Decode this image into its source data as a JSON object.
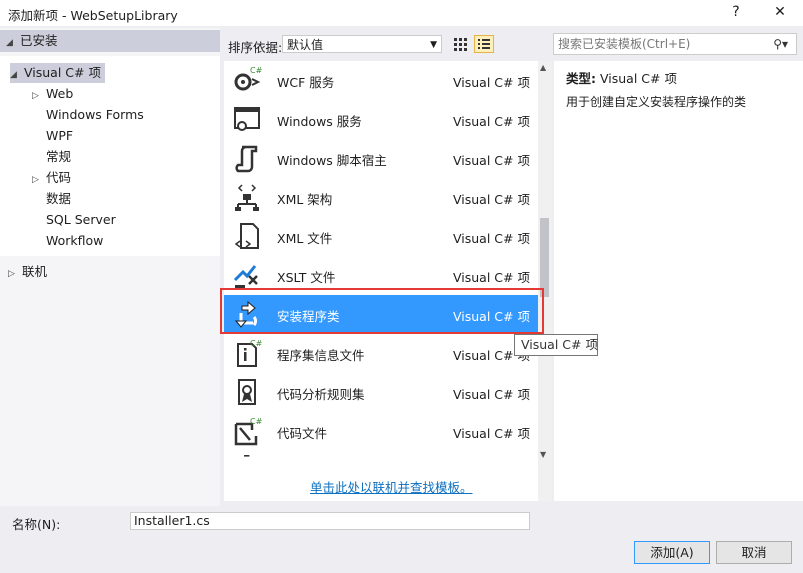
{
  "window": {
    "title": "添加新项 - WebSetupLibrary",
    "help": "?",
    "close": "✕"
  },
  "tree": {
    "installed": "已安装",
    "root": "Visual C# 项",
    "items": [
      "Web",
      "Windows Forms",
      "WPF",
      "常规",
      "代码",
      "数据",
      "SQL Server",
      "Workflow"
    ],
    "online": "联机"
  },
  "toolbar": {
    "sort_label": "排序依据:",
    "sort_value": "默认值"
  },
  "search": {
    "placeholder": "搜索已安装模板(Ctrl+E)"
  },
  "templates": [
    {
      "name": "WCF 服务",
      "type": "Visual C# 项",
      "icon": "wcf-service-icon"
    },
    {
      "name": "Windows 服务",
      "type": "Visual C# 项",
      "icon": "windows-service-icon"
    },
    {
      "name": "Windows 脚本宿主",
      "type": "Visual C# 项",
      "icon": "script-host-icon"
    },
    {
      "name": "XML 架构",
      "type": "Visual C# 项",
      "icon": "xml-schema-icon"
    },
    {
      "name": "XML 文件",
      "type": "Visual C# 项",
      "icon": "xml-file-icon"
    },
    {
      "name": "XSLT 文件",
      "type": "Visual C# 项",
      "icon": "xslt-file-icon"
    },
    {
      "name": "安装程序类",
      "type": "Visual C# 项",
      "icon": "installer-class-icon",
      "selected": true
    },
    {
      "name": "程序集信息文件",
      "type": "Visual C# 项",
      "icon": "assembly-info-icon"
    },
    {
      "name": "代码分析规则集",
      "type": "Visual C# 项",
      "icon": "ruleset-icon"
    },
    {
      "name": "代码文件",
      "type": "Visual C# 项",
      "icon": "code-file-icon"
    }
  ],
  "online_link": "单击此处以联机并查找模板。",
  "details": {
    "type_label": "类型:",
    "type_value": "Visual C# 项",
    "description": "用于创建自定义安装程序操作的类"
  },
  "tooltip": "Visual C# 项",
  "bottom": {
    "name_label": "名称(N):",
    "name_value": "Installer1.cs",
    "add_button": "添加(A)",
    "cancel_button": "取消"
  },
  "colors": {
    "selection": "#3399ff",
    "highlight_border": "#e53935",
    "link": "#0e70c0"
  }
}
